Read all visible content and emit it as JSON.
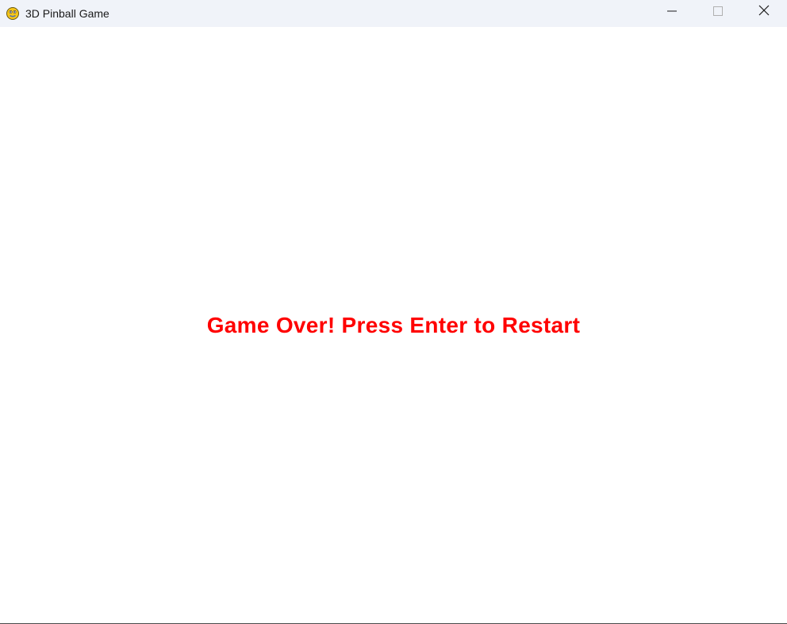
{
  "window": {
    "title": "3D Pinball Game",
    "app_icon": "pygame-snake-icon",
    "controls": {
      "minimize_icon": "minimize-icon",
      "maximize_icon": "maximize-icon",
      "close_icon": "close-icon"
    }
  },
  "game": {
    "message": "Game Over! Press Enter to Restart",
    "message_color": "#ff0000",
    "background_color": "#ffffff"
  }
}
